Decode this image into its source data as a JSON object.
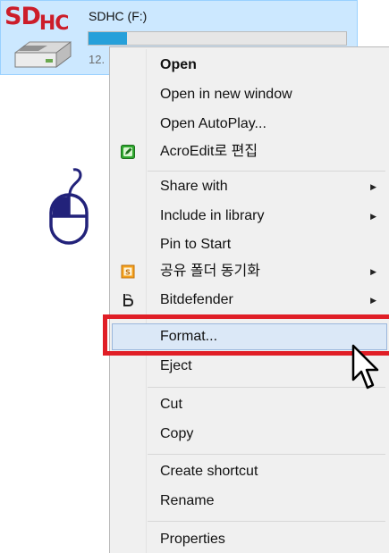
{
  "drive": {
    "logo_sd": "SD",
    "logo_hc": "HC",
    "name": "SDHC (F:)",
    "size_text": "12.",
    "usage_fraction": 0.15,
    "bar_fill_color": "#26a0da"
  },
  "decorations": {
    "mouse_icon": "mouse-icon",
    "cursor_icon": "arrow-cursor-icon",
    "highlight_color": "#e01e26"
  },
  "menu": {
    "items": [
      {
        "label": "Open",
        "bold": true
      },
      {
        "label": "Open in new window"
      },
      {
        "label": "Open AutoPlay..."
      },
      {
        "label": "AcroEdit로 편집",
        "icon": "acroedit-icon"
      },
      {
        "label": "Share with",
        "submenu": true
      },
      {
        "label": "Include in library",
        "submenu": true
      },
      {
        "label": "Pin to Start"
      },
      {
        "label": "공유 폴더 동기화",
        "icon": "sync-folder-icon",
        "submenu": true
      },
      {
        "label": "Bitdefender",
        "icon": "bitdefender-icon",
        "submenu": true
      },
      {
        "label": "Format...",
        "hover": true
      },
      {
        "label": "Eject"
      },
      {
        "label": "Cut"
      },
      {
        "label": "Copy"
      },
      {
        "label": "Create shortcut"
      },
      {
        "label": "Rename"
      },
      {
        "label": "Properties"
      }
    ],
    "submenu_arrow": "▶"
  }
}
